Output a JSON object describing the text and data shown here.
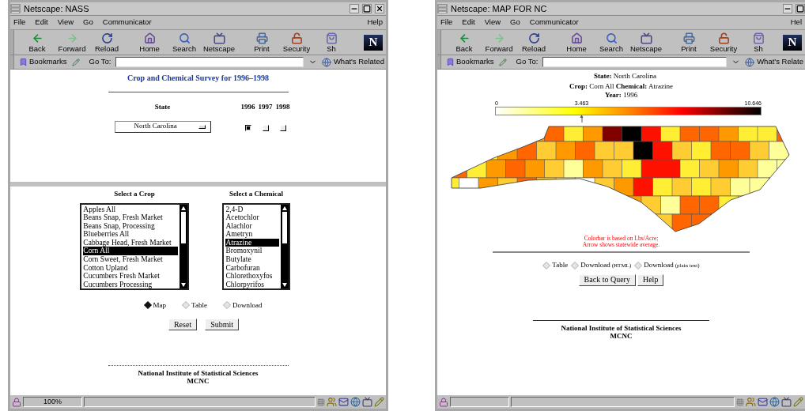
{
  "windows": [
    {
      "title": "Netscape: NASS",
      "menu": [
        "File",
        "Edit",
        "View",
        "Go",
        "Communicator"
      ],
      "menu_right": "Help",
      "toolbar": [
        [
          {
            "kind": "back",
            "label": "Back"
          },
          {
            "kind": "forward",
            "label": "Forward"
          },
          {
            "kind": "reload",
            "label": "Reload"
          }
        ],
        [
          {
            "kind": "home",
            "label": "Home"
          },
          {
            "kind": "search",
            "label": "Search"
          },
          {
            "kind": "netscape",
            "label": "Netscape"
          }
        ],
        [
          {
            "kind": "print",
            "label": "Print"
          },
          {
            "kind": "security",
            "label": "Security"
          },
          {
            "kind": "shop",
            "label": "Sh"
          }
        ]
      ],
      "logo": "N",
      "location_bar": {
        "bookmarks": "Bookmarks",
        "goto_label": "Go To:",
        "related": "What's Related"
      },
      "page": {
        "kind": "query_form",
        "heading": "Crop and Chemical Survey for 1996–1998",
        "state_label": "State",
        "state_select": "North Carolina",
        "years": [
          {
            "label": "1996",
            "checked": true
          },
          {
            "label": "1997",
            "checked": false
          },
          {
            "label": "1998",
            "checked": false
          }
        ],
        "crop_label": "Select a Crop",
        "chemical_label": "Select a Chemical",
        "crops": [
          {
            "label": "Apples All",
            "selected": false
          },
          {
            "label": "Beans Snap, Fresh Market",
            "selected": false
          },
          {
            "label": "Beans Snap, Processing",
            "selected": false
          },
          {
            "label": "Blueberries All",
            "selected": false
          },
          {
            "label": "Cabbage Head, Fresh Market",
            "selected": false
          },
          {
            "label": "Corn All",
            "selected": true
          },
          {
            "label": "Corn Sweet, Fresh Market",
            "selected": false
          },
          {
            "label": "Cotton Upland",
            "selected": false
          },
          {
            "label": "Cucumbers Fresh Market",
            "selected": false
          },
          {
            "label": "Cucumbers Processing",
            "selected": false
          }
        ],
        "chemicals": [
          {
            "label": "2,4-D",
            "selected": false
          },
          {
            "label": "Acetochlor",
            "selected": false
          },
          {
            "label": "Alachlor",
            "selected": false
          },
          {
            "label": "Ametryn",
            "selected": false
          },
          {
            "label": "Atrazine",
            "selected": true
          },
          {
            "label": "Bromoxynil",
            "selected": false
          },
          {
            "label": "Butylate",
            "selected": false
          },
          {
            "label": "Carbofuran",
            "selected": false
          },
          {
            "label": "Chlorethoxyfos",
            "selected": false
          },
          {
            "label": "Chlorpyrifos",
            "selected": false
          }
        ],
        "output_options": [
          {
            "label": "Map",
            "selected": true
          },
          {
            "label": "Table",
            "selected": false
          },
          {
            "label": "Download",
            "selected": false
          }
        ],
        "buttons": [
          "Reset",
          "Submit"
        ],
        "footer": [
          "National Institute of Statistical Sciences",
          "MCNC"
        ]
      },
      "status_bar": {
        "progress": "100%"
      }
    },
    {
      "title": "Netscape: MAP FOR NC",
      "menu": [
        "File",
        "Edit",
        "View",
        "Go",
        "Communicator"
      ],
      "menu_right": "Hel",
      "toolbar": [
        [
          {
            "kind": "back",
            "label": "Back"
          },
          {
            "kind": "forward",
            "label": "Forward"
          },
          {
            "kind": "reload",
            "label": "Reload"
          }
        ],
        [
          {
            "kind": "home",
            "label": "Home"
          },
          {
            "kind": "search",
            "label": "Search"
          },
          {
            "kind": "netscape",
            "label": "Netscape"
          }
        ],
        [
          {
            "kind": "print",
            "label": "Print"
          },
          {
            "kind": "security",
            "label": "Security"
          },
          {
            "kind": "shop",
            "label": "Sh"
          }
        ]
      ],
      "logo": "N",
      "location_bar": {
        "bookmarks": "Bookmarks",
        "goto_label": "Go To:",
        "related": "What's Relate"
      },
      "page": {
        "kind": "map_result",
        "state": {
          "label": "State:",
          "value": "North Carolina"
        },
        "crop": {
          "label": "Crop:",
          "value": "Corn All"
        },
        "chemical": {
          "label": "Chemical:",
          "value": "Atrazine"
        },
        "year": {
          "label": "Year:",
          "value": "1996"
        },
        "colorbar": {
          "min": "0",
          "average": "3.463",
          "max": "10.646"
        },
        "note": [
          "Colorbar is based on Lbs/Acre;",
          "Arrow shows statewide average."
        ],
        "options": [
          {
            "label": "Table",
            "selected": false
          },
          {
            "label": "Download",
            "note": "(HTML)",
            "selected": false
          },
          {
            "label": "Download",
            "note": "(plain text)",
            "selected": false
          }
        ],
        "buttons": [
          "Back to Query",
          "Help"
        ],
        "footer": [
          "National Institute of Statistical Sciences",
          "MCNC"
        ]
      }
    }
  ]
}
